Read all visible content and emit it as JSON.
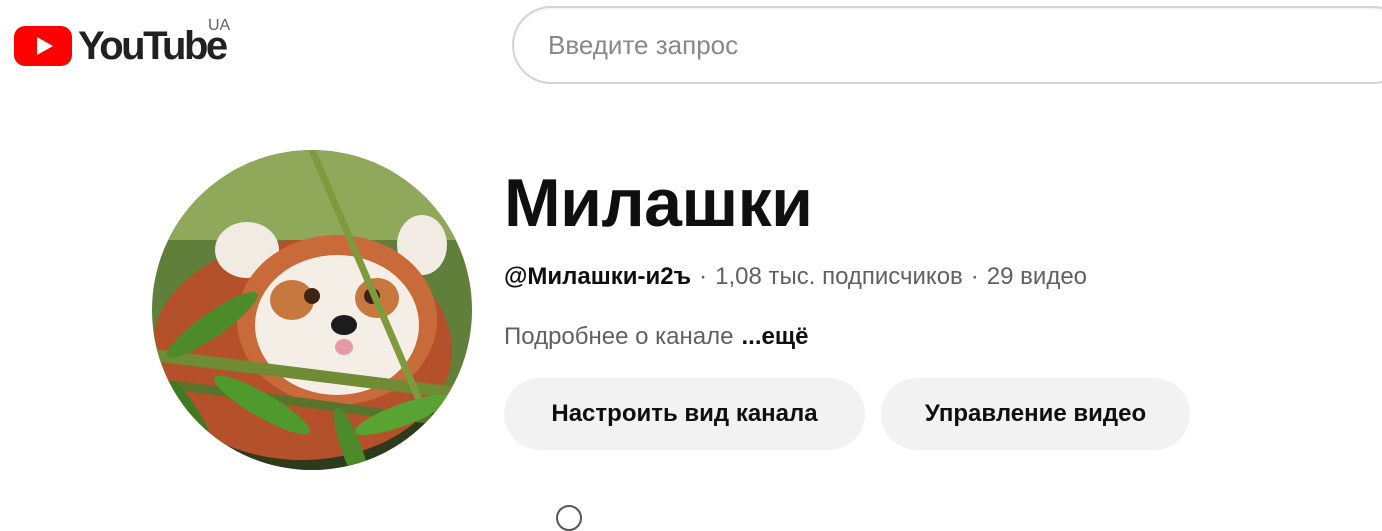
{
  "header": {
    "logo_text": "YouTube",
    "country_code": "UA",
    "search_placeholder": "Введите запрос",
    "brand_color": "#ff0000"
  },
  "channel": {
    "name": "Милашки",
    "handle": "@Милашки-и2ъ",
    "separator": "·",
    "subscribers": "1,08 тыс. подписчиков",
    "videos": "29 видео",
    "about_text": "Подробнее о канале",
    "more_label": "...ещё",
    "avatar_subject": "red-panda"
  },
  "actions": {
    "customize_label": "Настроить вид канала",
    "manage_label": "Управление видео"
  }
}
